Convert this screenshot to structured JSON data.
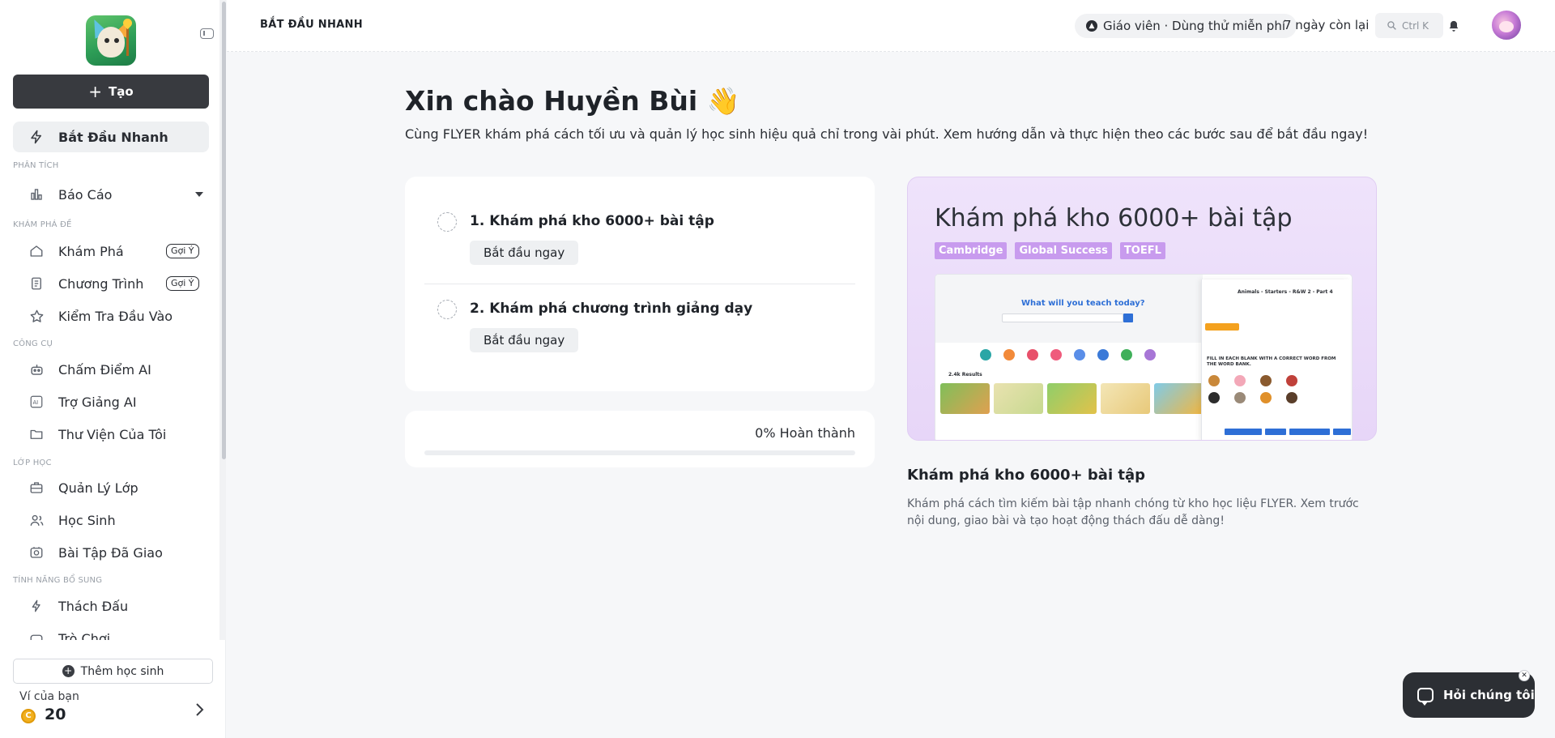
{
  "sidebar": {
    "create_label": "Tạo",
    "quick_start": "Bắt Đầu Nhanh",
    "sections": {
      "analysis": "PHÂN TÍCH",
      "explore": "KHÁM PHÁ ĐỀ",
      "tools": "CÔNG CỤ",
      "classes": "LỚP HỌC",
      "extra": "TÍNH NĂNG BỔ SUNG"
    },
    "items": {
      "reports": "Báo Cáo",
      "discover": "Khám Phá",
      "program": "Chương Trình",
      "entrance_test": "Kiểm Tra Đầu Vào",
      "ai_grading": "Chấm Điểm AI",
      "ai_assistant": "Trợ Giảng AI",
      "my_library": "Thư Viện Của Tôi",
      "class_manage": "Quản Lý Lớp",
      "students": "Học Sinh",
      "assigned": "Bài Tập Đã Giao",
      "challenge": "Thách Đấu",
      "games": "Trò Chơi"
    },
    "hint_badge": "Gợi Ý",
    "add_student": "Thêm học sinh",
    "wallet_label": "Ví của bạn",
    "wallet_amount": "20",
    "coin_symbol": "C"
  },
  "header": {
    "page_title": "BẮT ĐẦU NHANH",
    "trial_badge": "Giáo viên · Dùng thử miễn phí",
    "days_left": "7 ngày còn lại",
    "search_shortcut": "Ctrl K"
  },
  "main": {
    "greeting": "Xin chào Huyền Bùi 👋",
    "subtitle": "Cùng FLYER khám phá cách tối ưu và quản lý học sinh hiệu quả chỉ trong vài phút. Xem hướng dẫn và thực hiện theo các bước sau để bắt đầu ngay!",
    "steps": [
      {
        "title": "1. Khám phá kho 6000+ bài tập",
        "button": "Bắt đầu ngay"
      },
      {
        "title": "2. Khám phá chương trình giảng dạy",
        "button": "Bắt đầu ngay"
      }
    ],
    "progress_label": "0% Hoàn thành",
    "progress_value": 0,
    "preview": {
      "title": "Khám phá kho 6000+ bài tập",
      "tags": [
        "Cambridge",
        "Global Success",
        "TOEFL"
      ],
      "mock_heading": "What will you teach today?",
      "mock_results": "2.4k Results",
      "mock_panel_title": "Animals - Starters - R&W 2 - Part 4",
      "mock_instruction": "FILL IN EACH BLANK WITH A CORRECT WORD FROM THE WORD BANK."
    },
    "desc_title": "Khám phá kho 6000+ bài tập",
    "desc_text": "Khám phá cách tìm kiếm bài tập nhanh chóng từ kho học liệu FLYER. Xem trước nội dung, giao bài và tạo hoạt động thách đấu dễ dàng!"
  },
  "chat": {
    "label": "Hỏi chúng tôi",
    "close": "✕"
  },
  "colors": {
    "accent_dark": "#383a3f",
    "tag_purple": "#c89bee",
    "preview_bg": "#efe3fb",
    "progress_blue": "#4f8ef7"
  }
}
